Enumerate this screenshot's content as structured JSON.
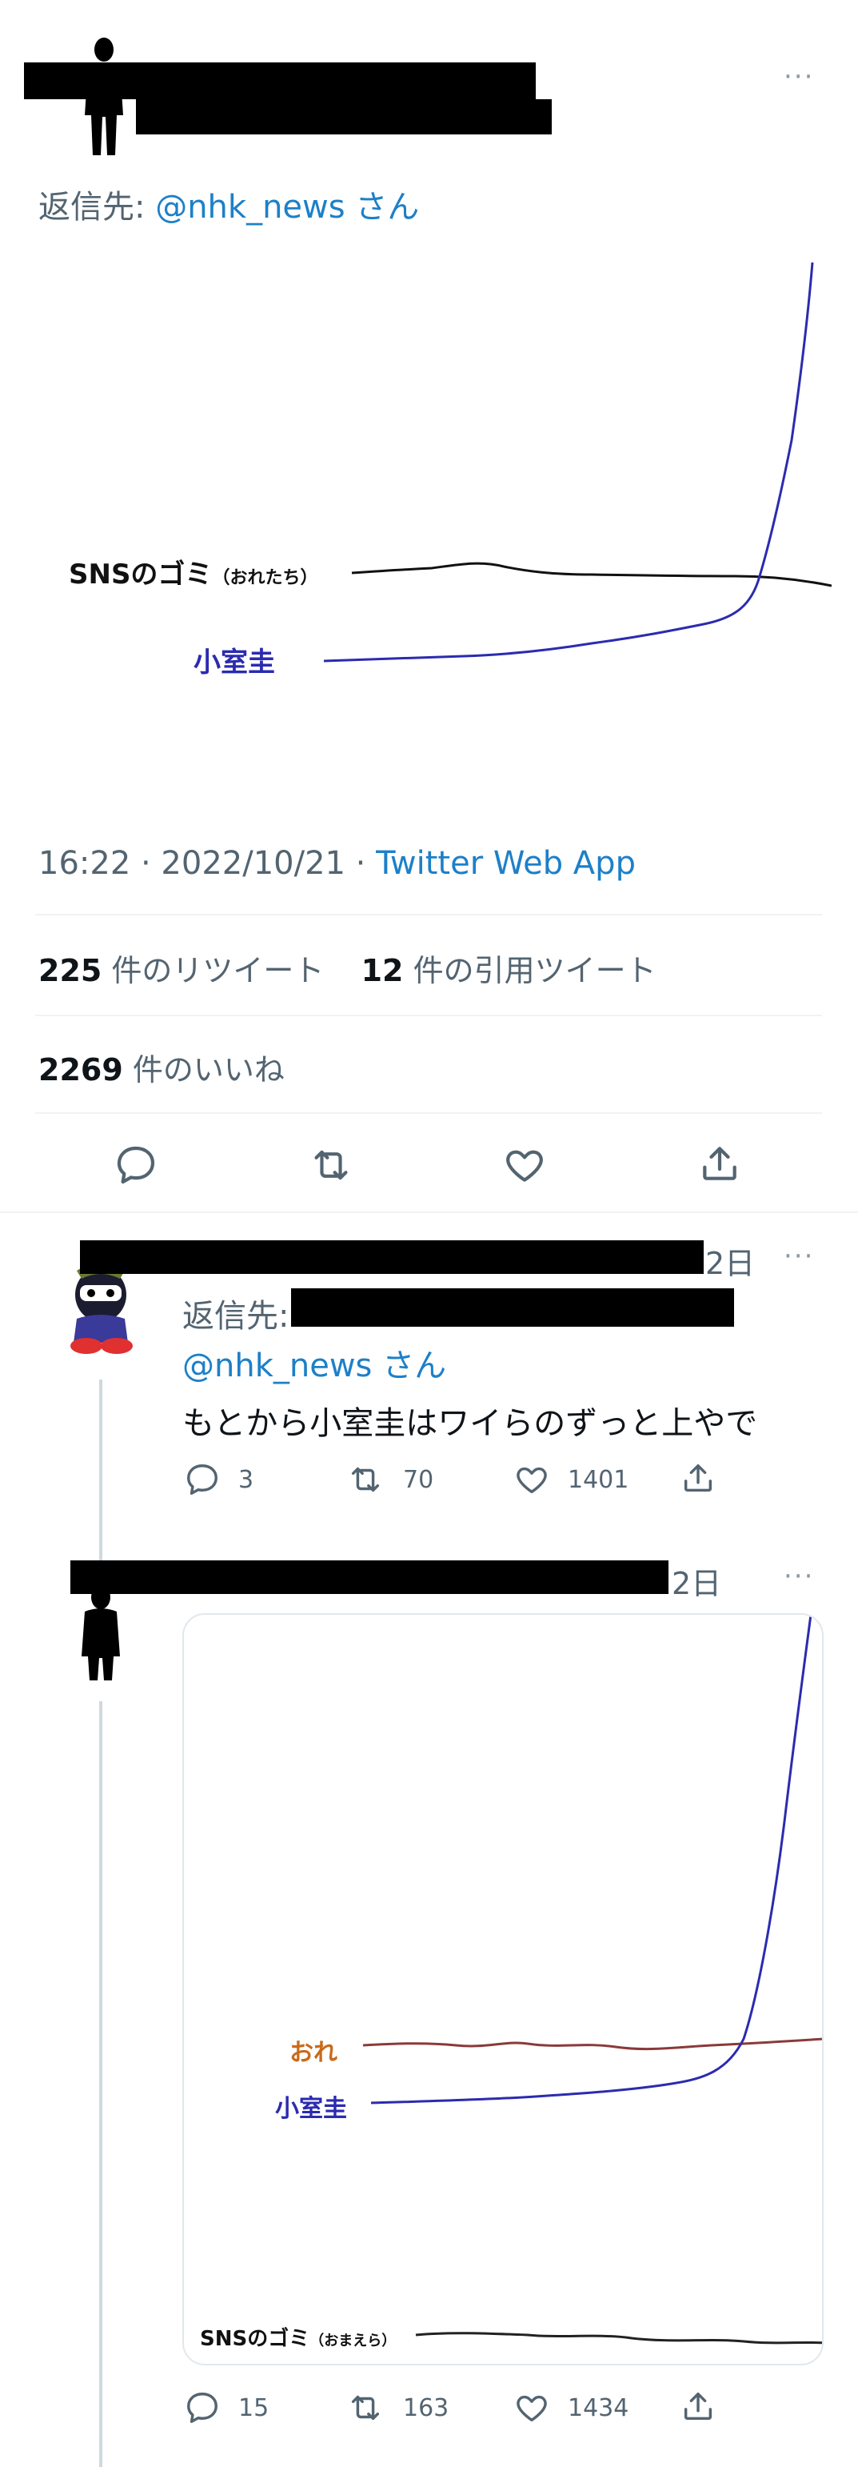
{
  "tweet": {
    "reply_prefix": "返信先: ",
    "reply_handle": "@nhk_news",
    "reply_suffix": " さん",
    "chart_label_top": "SNSのゴミ",
    "chart_label_top_sub": "（おれたち）",
    "chart_label_bottom": "小室圭",
    "timestamp": "16:22 · 2022/10/21 · ",
    "client": "Twitter Web App",
    "retweet_count": "225",
    "retweet_label": " 件のリツイート",
    "quote_count": "12",
    "quote_label": " 件の引用ツイート",
    "like_count": "2269",
    "like_label": " 件のいいね"
  },
  "reply1": {
    "age": "2日",
    "reply_prefix": "返信先:",
    "reply_handle": "@nhk_news",
    "reply_suffix": " さん",
    "text": "もとから小室圭はワイらのずっと上やで",
    "replies": "3",
    "retweets": "70",
    "likes": "1401"
  },
  "reply2": {
    "age": "2日",
    "chart_label_ore": "おれ",
    "chart_label_komuro": "小室圭",
    "chart_label_sns": "SNSのゴミ",
    "chart_label_sns_sub": "（おまえら）",
    "replies": "15",
    "retweets": "163",
    "likes": "1434"
  },
  "colors": {
    "link": "#1d9bf0",
    "muted": "#536471",
    "komuro_line": "#2b2bb0",
    "ore_line": "#8a3a3a"
  }
}
